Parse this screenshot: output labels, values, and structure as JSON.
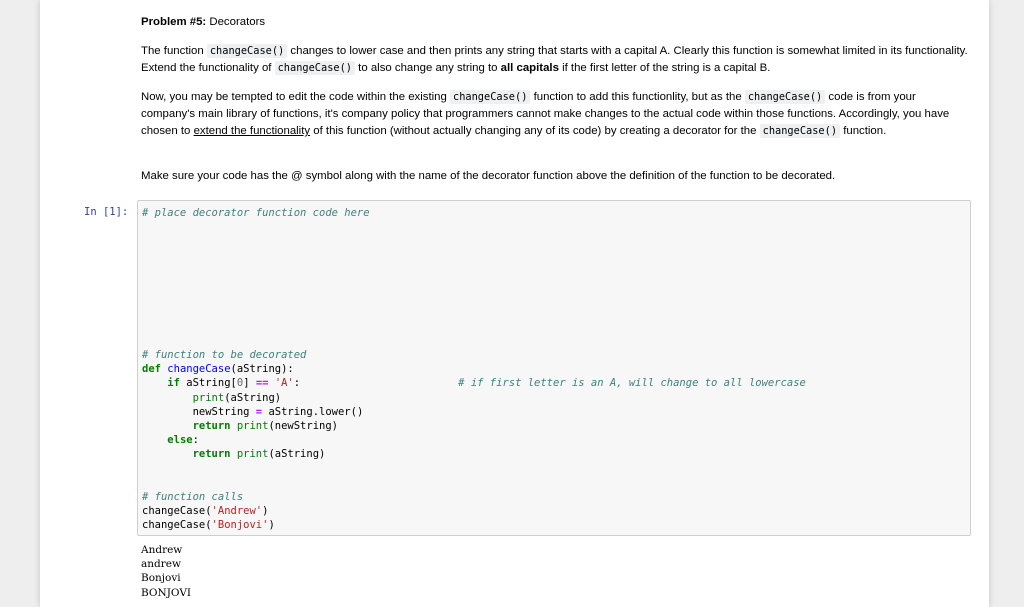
{
  "markdown": {
    "heading_bold": "Problem #5:",
    "heading_rest": " Decorators",
    "p1": {
      "t1": "The function ",
      "c1": "changeCase()",
      "t2": " changes to lower case and then prints any string that starts with a capital A. Clearly this function is somewhat limited in its functionality. Extend the functionality of ",
      "c2": "changeCase()",
      "t3": " to also change any string to ",
      "b1": "all capitals",
      "t4": " if the first letter of the string is a capital B."
    },
    "p2": {
      "t1": "Now, you may be tempted to edit the code within the existing ",
      "c1": "changeCase()",
      "t2": " function to add this functionlity, but as the ",
      "c2": "changeCase()",
      "t3": " code is from your company's main library of functions, it's company policy that programmers cannot make changes to the actual code within those functions. Accordingly, you have chosen to ",
      "u1": "extend the functionality",
      "t4": " of this function (without actually changing any of its code) by creating a decorator for the ",
      "c3": "changeCase()",
      "t5": " function."
    },
    "p3": "Make sure your code has the @ symbol along with the name of the decorator function above the definition of the function to be decorated."
  },
  "cell": {
    "prompt": "In [1]:",
    "code": {
      "comment_top": "# place decorator function code here",
      "comment_decorated": "# function to be decorated",
      "def_kw": "def",
      "func_name": "changeCase",
      "def_params": "(aString):",
      "if_kw": "if",
      "if_expr": " aString[",
      "if_idx": "0",
      "if_close": "] ",
      "eq_op": "==",
      "if_str": "'A'",
      "colon": ":",
      "inline_comment": "# if first letter is an A, will change to all lowercase",
      "print_fn": "print",
      "print_args": "(aString)",
      "assign_lhs": "newString ",
      "assign_op": "=",
      "assign_rhs": " aString.lower()",
      "return_kw": "return",
      "ret_print_args_new": "(newString)",
      "else_kw": "else",
      "else_colon": ":",
      "ret_print_args": "(aString)",
      "comment_calls": "# function calls",
      "call_name": "changeCase(",
      "call_arg1": "'Andrew'",
      "call_arg2": "'Bonjovi'",
      "call_close": ")"
    },
    "output": [
      "Andrew",
      "andrew",
      "Bonjovi",
      "BONJOVI"
    ]
  }
}
